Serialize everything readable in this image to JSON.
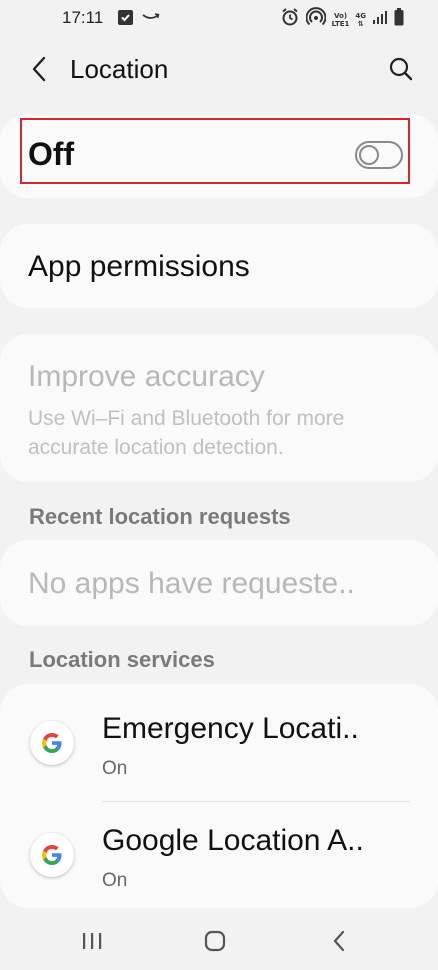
{
  "status_bar": {
    "time": "17:11",
    "icons": [
      "checkbox-icon",
      "amazon-icon",
      "alarm-icon",
      "hotspot-icon",
      "volte-icon",
      "4g-icon",
      "signal-icon",
      "battery-icon"
    ],
    "network_top": "Vo)",
    "network_bottom": "LTE1",
    "gen_label": "4G"
  },
  "header": {
    "title": "Location"
  },
  "location_toggle": {
    "label": "Off",
    "enabled": false,
    "highlight_color": "#d6262f"
  },
  "app_permissions": {
    "label": "App permissions"
  },
  "improve_accuracy": {
    "title": "Improve accuracy",
    "description": "Use Wi–Fi and Bluetooth for more accurate location detection.",
    "disabled": true
  },
  "recent_requests": {
    "section_title": "Recent location requests",
    "empty_text": "No apps have requeste.."
  },
  "location_services": {
    "section_title": "Location services",
    "items": [
      {
        "name": "Emergency Locati..",
        "status": "On",
        "icon": "google-icon"
      },
      {
        "name": "Google Location A..",
        "status": "On",
        "icon": "google-icon"
      }
    ]
  },
  "nav_bar": {
    "buttons": [
      "recents-icon",
      "home-icon",
      "back-icon"
    ]
  }
}
